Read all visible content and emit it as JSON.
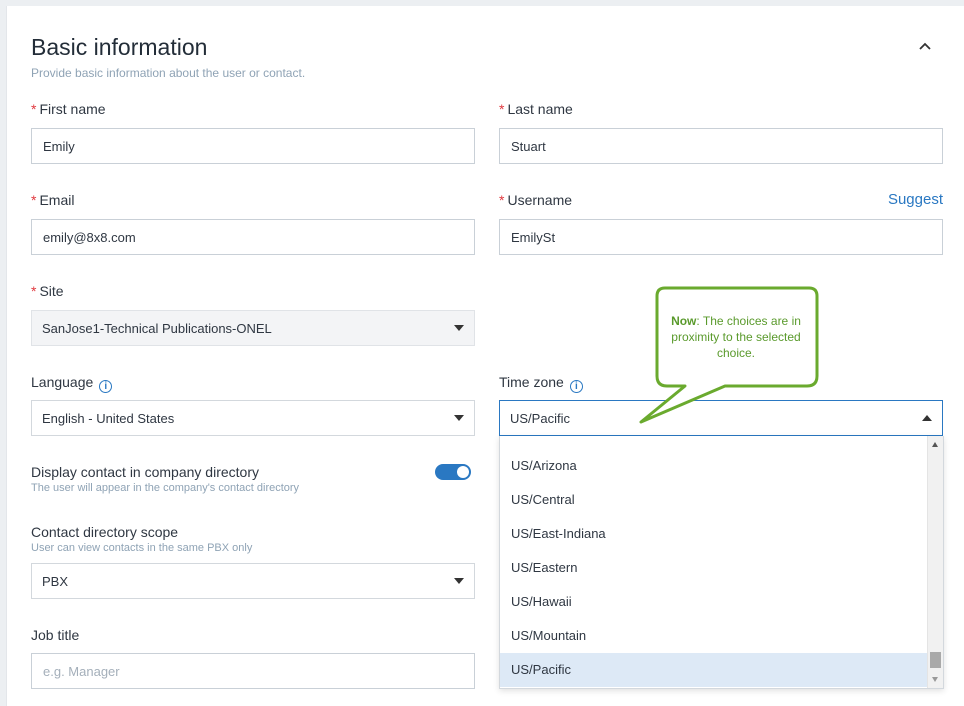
{
  "section": {
    "title": "Basic information",
    "subtitle": "Provide basic information about the user or contact."
  },
  "fields": {
    "first_name": {
      "label": "First name",
      "value": "Emily"
    },
    "last_name": {
      "label": "Last name",
      "value": "Stuart"
    },
    "email": {
      "label": "Email",
      "value": "emily@8x8.com"
    },
    "username": {
      "label": "Username",
      "value": "EmilySt",
      "suggest_label": "Suggest"
    },
    "site": {
      "label": "Site",
      "value": "SanJose1-Technical Publications-ONEL"
    },
    "language": {
      "label": "Language",
      "value": "English - United States"
    },
    "time_zone": {
      "label": "Time zone",
      "value": "US/Pacific"
    },
    "display_contact": {
      "label": "Display contact in company directory",
      "hint": "The user will appear in the company's contact directory",
      "enabled": true
    },
    "contact_scope": {
      "label": "Contact directory scope",
      "hint": "User can view contacts in the same PBX only",
      "value": "PBX"
    },
    "job_title": {
      "label": "Job title",
      "placeholder": "e.g. Manager"
    }
  },
  "timezone_options": [
    "US/Arizona",
    "US/Central",
    "US/East-Indiana",
    "US/Eastern",
    "US/Hawaii",
    "US/Mountain",
    "US/Pacific"
  ],
  "timezone_selected": "US/Pacific",
  "callout": {
    "bold": "Now",
    "text": ": The choices are in proximity to the selected choice."
  },
  "colors": {
    "accent": "#2a78c2",
    "required": "#e0383e",
    "callout_border": "#6aaa2e",
    "selected_option": "#dde9f6"
  },
  "icons": {
    "collapse": "chevron-up-icon",
    "info": "info-icon",
    "caret": "caret-down-icon"
  }
}
